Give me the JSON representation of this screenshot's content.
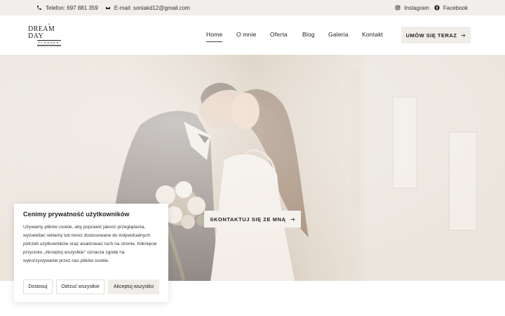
{
  "topbar": {
    "phone": "Telefon: 697 881 359",
    "email": "E-mail: soniakd12@gmail.com",
    "instagram": "Instagram",
    "facebook": "Facebook"
  },
  "header": {
    "logo": {
      "line1": "DREAM DAY",
      "line2": "PLANNER",
      "line3": "WEDDING PLANNER"
    },
    "nav": [
      {
        "label": "Home"
      },
      {
        "label": "O mnie"
      },
      {
        "label": "Oferta"
      },
      {
        "label": "Blog"
      },
      {
        "label": "Galeria"
      },
      {
        "label": "Kontakt"
      }
    ],
    "cta_label": "UMÓW SIĘ TERAZ"
  },
  "hero": {
    "button_label": "SKONTAKTUJ SIĘ ZE MNĄ"
  },
  "cookie": {
    "title": "Cenimy prywatność użytkowników",
    "text": "Używamy plików cookie, aby poprawić jakość przeglądania, wyświetlać reklamy lub treści dostosowane do indywidualnych potrzeb użytkowników oraz analizować ruch na stronie. Kliknięcie przycisku „Akceptuj wszystkie\" oznacza zgodę na wykorzystywanie przez nas plików cookie.",
    "buttons": {
      "customize": "Dostosuj",
      "reject": "Odrzuć wszystkie",
      "accept": "Akceptuj wszystko"
    }
  },
  "colors": {
    "topbar_bg": "#f1efec",
    "button_bg": "#f0ede8",
    "text": "#2a2a2a"
  }
}
